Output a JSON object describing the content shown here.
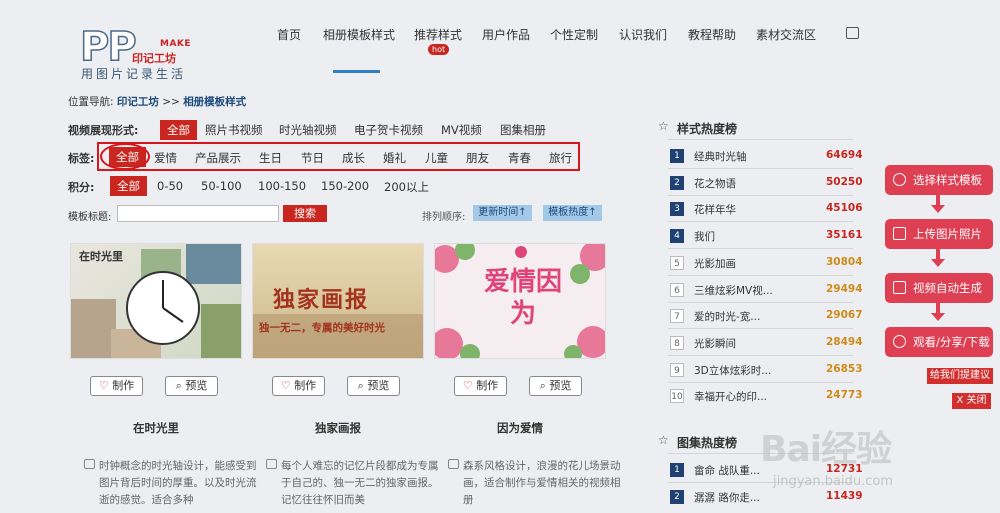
{
  "brand": {
    "logo_letters": "PP",
    "make": "MAKE",
    "name": "印记工坊",
    "slogan": "用图片记录生活"
  },
  "nav": {
    "items": [
      "首页",
      "相册模板样式",
      "推荐样式",
      "用户作品",
      "个性定制",
      "认识我们",
      "教程帮助",
      "素材交流区"
    ],
    "hot": "hot"
  },
  "breadcrumb": {
    "prefix": "位置导航:",
    "site": "印记工坊",
    "sep": ">>",
    "current": "相册模板样式"
  },
  "filters": {
    "video_label": "视频展现形式:",
    "video_options": [
      "全部",
      "照片书视频",
      "时光轴视频",
      "电子贺卡视频",
      "MV视频",
      "图集相册"
    ],
    "tag_label": "标签:",
    "tag_options": [
      "全部",
      "爱情",
      "产品展示",
      "生日",
      "节日",
      "成长",
      "婚礼",
      "儿童",
      "朋友",
      "青春",
      "旅行"
    ],
    "points_label": "积分:",
    "points_options": [
      "全部",
      "0-50",
      "50-100",
      "100-150",
      "150-200",
      "200以上"
    ]
  },
  "search": {
    "label": "模板标题:",
    "button": "搜索",
    "sort_label": "排列顺序:",
    "sort_time": "更新时间↑",
    "sort_hot": "模板热度↑"
  },
  "cards": [
    {
      "title": "在时光里",
      "make": "制作",
      "preview": "预览",
      "desc": "时钟概念的时光轴设计，能感受到图片背后时间的厚重。以及时光流逝的感觉。适合多种",
      "thumb_text": "在时光里"
    },
    {
      "title": "独家画报",
      "make": "制作",
      "preview": "预览",
      "desc": "每个人难忘的记忆片段都成为专属于自己的、独一无二的独家画报。记忆往往怀旧而美",
      "thumb_text": "独家画报",
      "thumb_sub": "独一无二，专属的美好时光"
    },
    {
      "title": "因为爱情",
      "make": "制作",
      "preview": "预览",
      "desc": "森系风格设计，浪漫的花儿场景动画，适合制作与爱情相关的视频相册",
      "thumb_text": "爱情因为"
    }
  ],
  "rank_style": {
    "title": "样式热度榜",
    "items": [
      {
        "rank": "1",
        "name": "经典时光轴",
        "val": "64694"
      },
      {
        "rank": "2",
        "name": "花之物语",
        "val": "50250"
      },
      {
        "rank": "3",
        "name": "花样年华",
        "val": "45106"
      },
      {
        "rank": "4",
        "name": "我们",
        "val": "35161"
      },
      {
        "rank": "5",
        "name": "光影加画",
        "val": "30804"
      },
      {
        "rank": "6",
        "name": "三维炫彩MV视...",
        "val": "29494"
      },
      {
        "rank": "7",
        "name": "爱的时光-宽...",
        "val": "29067"
      },
      {
        "rank": "8",
        "name": "光影瞬间",
        "val": "28494"
      },
      {
        "rank": "9",
        "name": "3D立体炫彩时...",
        "val": "26853"
      },
      {
        "rank": "10",
        "name": "幸福开心的印...",
        "val": "24773"
      }
    ]
  },
  "rank_album": {
    "title": "图集热度榜",
    "items": [
      {
        "rank": "1",
        "name": "畲命 战队重...",
        "val": "12731"
      },
      {
        "rank": "2",
        "name": "潺潺 路你走...",
        "val": "11439"
      }
    ]
  },
  "flow": {
    "steps": [
      "选择样式模板",
      "上传图片照片",
      "视频自动生成",
      "观看/分享/下载"
    ],
    "suggest": "给我们提建议",
    "close": "X 关闭"
  },
  "watermark": {
    "text": "Bai经验",
    "url": "jingyan.baidu.com"
  },
  "colors": {
    "accent": "#c8261f",
    "navy": "#1f4272",
    "flow": "#de3f52"
  }
}
